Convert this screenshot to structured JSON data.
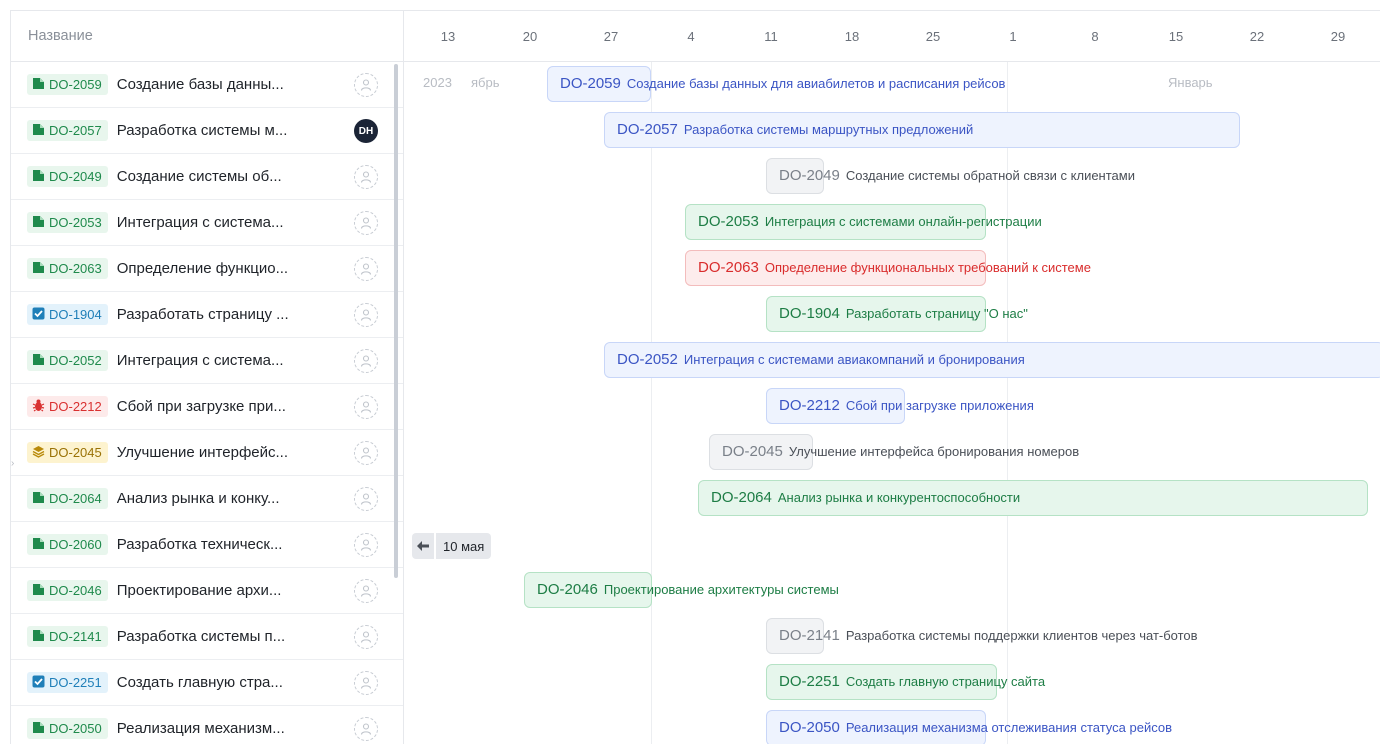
{
  "left_header": {
    "column_title": "Название"
  },
  "tasks": [
    {
      "key": "DO-2059",
      "title": "Создание базы данны...",
      "type": "story",
      "chip_color": "green",
      "assignee": ""
    },
    {
      "key": "DO-2057",
      "title": "Разработка системы м...",
      "type": "story",
      "chip_color": "green",
      "assignee": "DH"
    },
    {
      "key": "DO-2049",
      "title": "Создание системы об...",
      "type": "story",
      "chip_color": "green",
      "assignee": ""
    },
    {
      "key": "DO-2053",
      "title": "Интеграция с система...",
      "type": "story",
      "chip_color": "green",
      "assignee": ""
    },
    {
      "key": "DO-2063",
      "title": "Определение функцио...",
      "type": "story",
      "chip_color": "green",
      "assignee": ""
    },
    {
      "key": "DO-1904",
      "title": "Разработать страницу ...",
      "type": "task",
      "chip_color": "blue",
      "assignee": ""
    },
    {
      "key": "DO-2052",
      "title": "Интеграция с система...",
      "type": "story",
      "chip_color": "green",
      "assignee": ""
    },
    {
      "key": "DO-2212",
      "title": "Сбой при загрузке при...",
      "type": "bug",
      "chip_color": "red",
      "assignee": ""
    },
    {
      "key": "DO-2045",
      "title": "Улучшение интерфейс...",
      "type": "epic",
      "chip_color": "yellow",
      "assignee": ""
    },
    {
      "key": "DO-2064",
      "title": "Анализ рынка и конку...",
      "type": "story",
      "chip_color": "green",
      "assignee": ""
    },
    {
      "key": "DO-2060",
      "title": "Разработка техническ...",
      "type": "story",
      "chip_color": "green",
      "assignee": ""
    },
    {
      "key": "DO-2046",
      "title": "Проектирование архи...",
      "type": "story",
      "chip_color": "green",
      "assignee": ""
    },
    {
      "key": "DO-2141",
      "title": "Разработка системы п...",
      "type": "story",
      "chip_color": "green",
      "assignee": ""
    },
    {
      "key": "DO-2251",
      "title": "Создать главную стра...",
      "type": "task",
      "chip_color": "blue",
      "assignee": ""
    },
    {
      "key": "DO-2050",
      "title": "Реализация механизм...",
      "type": "story",
      "chip_color": "green",
      "assignee": ""
    }
  ],
  "timeline": {
    "days": [
      "13",
      "20",
      "27",
      "4",
      "11",
      "18",
      "25",
      "1",
      "8",
      "15",
      "22",
      "29"
    ],
    "months": [
      "2023",
      "ябрь",
      "Январь"
    ],
    "scroll_hint": "10 мая"
  },
  "bars": [
    {
      "key": "DO-2059",
      "title": "Создание базы данных для авиабилетов и расписания рейсов",
      "color": "blue"
    },
    {
      "key": "DO-2057",
      "title": "Разработка системы маршрутных предложений",
      "color": "blue"
    },
    {
      "key": "DO-2049",
      "title": "Создание системы обратной связи с клиентами",
      "color": "gray"
    },
    {
      "key": "DO-2053",
      "title": "Интеграция с системами онлайн-регистрации",
      "color": "green"
    },
    {
      "key": "DO-2063",
      "title": "Определение функциональных требований к системе",
      "color": "red"
    },
    {
      "key": "DO-1904",
      "title": "Разработать страницу \"О нас\"",
      "color": "green"
    },
    {
      "key": "DO-2052",
      "title": "Интеграция с системами авиакомпаний и бронирования",
      "color": "blue"
    },
    {
      "key": "DO-2212",
      "title": "Сбой при загрузке приложения",
      "color": "blue"
    },
    {
      "key": "DO-2045",
      "title": "Улучшение интерфейса бронирования номеров",
      "color": "gray"
    },
    {
      "key": "DO-2064",
      "title": "Анализ рынка и конкурентоспособности",
      "color": "green"
    },
    {
      "key": "DO-2060",
      "title": "",
      "color": "none"
    },
    {
      "key": "DO-2046",
      "title": "Проектирование архитектуры системы",
      "color": "green"
    },
    {
      "key": "DO-2141",
      "title": "Разработка системы поддержки клиентов через чат-ботов",
      "color": "gray"
    },
    {
      "key": "DO-2251",
      "title": "Создать главную страницу сайта",
      "color": "green"
    },
    {
      "key": "DO-2050",
      "title": "Реализация механизма отслеживания статуса рейсов",
      "color": "blue"
    }
  ]
}
